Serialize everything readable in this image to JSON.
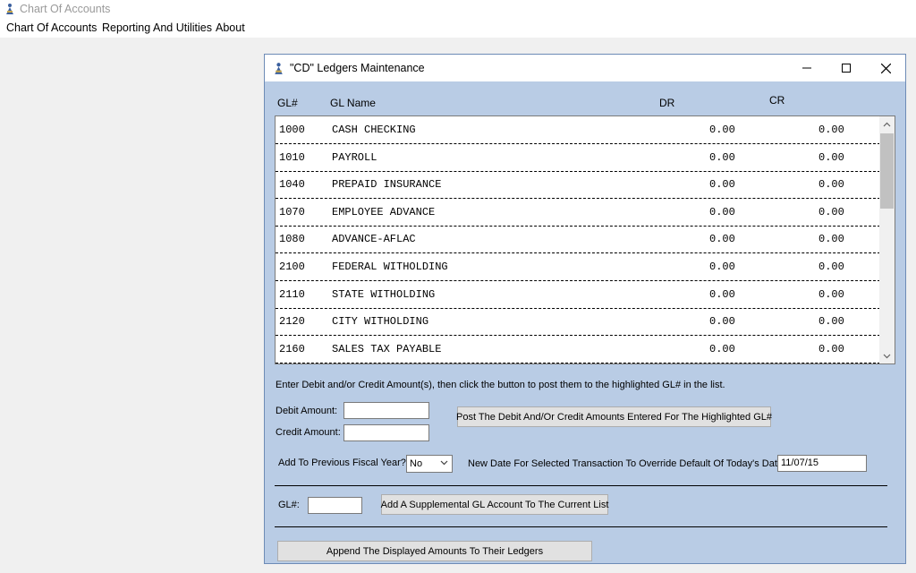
{
  "app": {
    "title": "Chart Of Accounts",
    "menu": [
      "Chart Of Accounts",
      "Reporting And Utilities",
      "About"
    ]
  },
  "dialog": {
    "title": "\"CD\" Ledgers Maintenance",
    "columns": {
      "gl": "GL#",
      "name": "GL Name",
      "dr": "DR",
      "cr": "CR"
    },
    "rows": [
      {
        "gl": "1000",
        "name": "CASH CHECKING",
        "dr": "0.00",
        "cr": "0.00"
      },
      {
        "gl": "1010",
        "name": "PAYROLL",
        "dr": "0.00",
        "cr": "0.00"
      },
      {
        "gl": "1040",
        "name": "PREPAID INSURANCE",
        "dr": "0.00",
        "cr": "0.00"
      },
      {
        "gl": "1070",
        "name": "EMPLOYEE ADVANCE",
        "dr": "0.00",
        "cr": "0.00"
      },
      {
        "gl": "1080",
        "name": "ADVANCE-AFLAC",
        "dr": "0.00",
        "cr": "0.00"
      },
      {
        "gl": "2100",
        "name": "FEDERAL WITHOLDING",
        "dr": "0.00",
        "cr": "0.00"
      },
      {
        "gl": "2110",
        "name": "STATE WITHOLDING",
        "dr": "0.00",
        "cr": "0.00"
      },
      {
        "gl": "2120",
        "name": "CITY WITHOLDING",
        "dr": "0.00",
        "cr": "0.00"
      },
      {
        "gl": "2160",
        "name": "SALES TAX PAYABLE",
        "dr": "0.00",
        "cr": "0.00"
      }
    ],
    "instruction": "Enter Debit and/or Credit Amount(s), then click the button to post them to the highlighted GL# in the list.",
    "debit_label": "Debit Amount:",
    "debit_value": "",
    "credit_label": "Credit Amount:",
    "credit_value": "",
    "post_button": "Post The Debit And/Or Credit Amounts Entered For The Highlighted GL#",
    "prev_year_label": "Add To Previous Fiscal Year?",
    "prev_year_value": "No",
    "new_date_label": "New Date For Selected Transaction To Override Default Of Today's Date:",
    "new_date_value": "11/07/15",
    "gl_label": "GL#:",
    "gl_value": "",
    "add_gl_button": "Add A Supplemental GL Account To The Current List",
    "append_button": "Append The Displayed Amounts To Their Ledgers"
  }
}
